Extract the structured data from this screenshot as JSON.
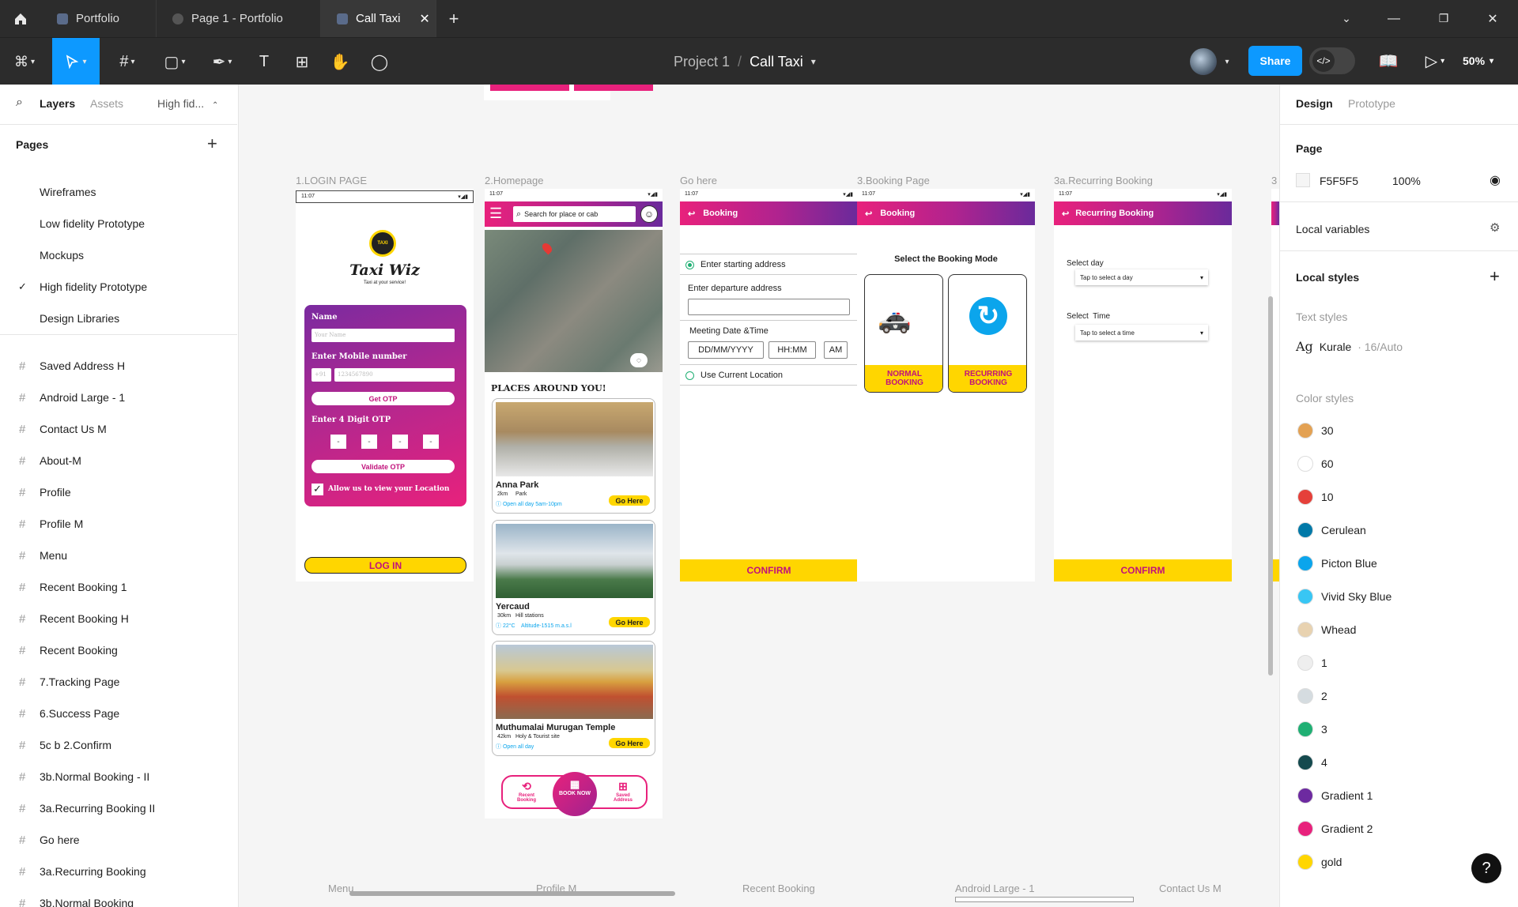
{
  "tabs": [
    {
      "label": "Portfolio"
    },
    {
      "label": "Page 1 - Portfolio"
    },
    {
      "label": "Call Taxi"
    }
  ],
  "toolbar": {
    "project": "Project 1",
    "separator": "/",
    "file": "Call Taxi",
    "share_label": "Share",
    "zoom": "50%"
  },
  "left": {
    "tab_layers": "Layers",
    "tab_assets": "Assets",
    "page_dropdown": "High fid...",
    "pages_header": "Pages",
    "pages": [
      {
        "label": "Wireframes"
      },
      {
        "label": "Low fidelity Prototype"
      },
      {
        "label": "Mockups"
      },
      {
        "label": "High fidelity Prototype"
      },
      {
        "label": "Design Libraries"
      }
    ],
    "layers": [
      {
        "label": "Saved Address H"
      },
      {
        "label": "Android Large - 1"
      },
      {
        "label": "Contact Us M"
      },
      {
        "label": "About-M"
      },
      {
        "label": "Profile"
      },
      {
        "label": "Profile M"
      },
      {
        "label": "Menu"
      },
      {
        "label": "Recent Booking 1"
      },
      {
        "label": "Recent Booking H"
      },
      {
        "label": "Recent Booking"
      },
      {
        "label": "7.Tracking Page"
      },
      {
        "label": "6.Success Page"
      },
      {
        "label": "5c b 2.Confirm"
      },
      {
        "label": "3b.Normal Booking - II"
      },
      {
        "label": "3a.Recurring Booking II"
      },
      {
        "label": "Go here"
      },
      {
        "label": "3a.Recurring Booking"
      },
      {
        "label": "3b.Normal Booking"
      }
    ]
  },
  "right": {
    "tab_design": "Design",
    "tab_prototype": "Prototype",
    "page_title": "Page",
    "page_color": "F5F5F5",
    "page_opacity": "100%",
    "local_variables": "Local variables",
    "local_styles": "Local styles",
    "text_styles": "Text styles",
    "text_style_sample": "Ag",
    "text_style_name": "Kurale",
    "text_style_meta": "· 16/Auto",
    "color_styles": "Color styles",
    "colors": [
      {
        "name": "30",
        "hex": "#E3A153"
      },
      {
        "name": "60",
        "hex": "#FFFFFF"
      },
      {
        "name": "10",
        "hex": "#E5403A"
      },
      {
        "name": "Cerulean",
        "hex": "#0079A8"
      },
      {
        "name": "Picton Blue",
        "hex": "#0BA5EC"
      },
      {
        "name": "Vivid Sky Blue",
        "hex": "#38C6F4"
      },
      {
        "name": "Whead",
        "hex": "#E8D2B0"
      },
      {
        "name": "1",
        "hex": "#EEEEEE"
      },
      {
        "name": "2",
        "hex": "#D5DCE0"
      },
      {
        "name": "3",
        "hex": "#1FAF73"
      },
      {
        "name": "4",
        "hex": "#154A4E"
      },
      {
        "name": "Gradient 1",
        "hex": "#6D2AA0"
      },
      {
        "name": "Gradient 2",
        "hex": "#E8217C"
      },
      {
        "name": "gold",
        "hex": "#FFD600"
      }
    ],
    "help": "?"
  },
  "canvas": {
    "frame_labels": {
      "login": "1.LOGIN PAGE",
      "home": "2.Homepage",
      "gohere": "Go here",
      "booking": "3.Booking Page",
      "recurring": "3a.Recurring Booking",
      "next": "3"
    },
    "bottom_labels": {
      "menu": "Menu",
      "profile": "Profile M",
      "recent": "Recent Booking",
      "android": "Android Large - 1",
      "contact": "Contact Us M"
    },
    "status_time": "11:07",
    "login": {
      "brand": "Taxi Wiz",
      "tagline": "Taxi at your service!",
      "taxi_badge": "TAXI",
      "name_label": "Name",
      "name_placeholder": "Your Name",
      "mobile_label": "Enter Mobile number",
      "country_code": "+91",
      "mobile_placeholder": "1234567890",
      "get_otp": "Get OTP",
      "otp_label": "Enter 4 Digit OTP",
      "otp_digit": "-",
      "validate_otp": "Validate OTP",
      "allow_location": "Allow us to view your Location",
      "login_btn": "LOG IN"
    },
    "home": {
      "search_placeholder": "Search for place or cab",
      "places_title": "PLACES AROUND YOU!",
      "places": [
        {
          "name": "Anna Park",
          "meta": "2km     Park",
          "info": "Open all day 5am-10pm",
          "btn": "Go Here"
        },
        {
          "name": "Yercaud",
          "meta": "30km   Hill stations",
          "info": "22°C    Altitude-1515 m.a.s.l",
          "btn": "Go Here"
        },
        {
          "name": "Muthumalai Murugan Temple",
          "meta": "42km   Holy & Tourist site",
          "info": "Open all day",
          "btn": "Go Here"
        }
      ],
      "nav_recent": "Recent Booking",
      "nav_book": "BOOK NOW",
      "nav_saved": "Saved Address"
    },
    "gohere": {
      "header": "Booking",
      "start": "Enter starting address",
      "departure": "Enter departure address",
      "meeting": "Meeting Date &Time",
      "date": "DD/MM/YYYY",
      "time": "HH:MM",
      "ampm": "AM",
      "current_loc": "Use Current Location",
      "confirm": "CONFIRM"
    },
    "booking": {
      "header": "Booking",
      "mode_title": "Select the Booking Mode",
      "normal": "NORMAL BOOKING",
      "recurring": "RECURRING BOOKING"
    },
    "recurring": {
      "header": "Recurring Booking",
      "day_label": "Select day",
      "day_placeholder": "Tap to select a day",
      "time_label": "Select  Time",
      "time_placeholder": "Tap to select a time",
      "confirm": "CONFIRM"
    }
  }
}
